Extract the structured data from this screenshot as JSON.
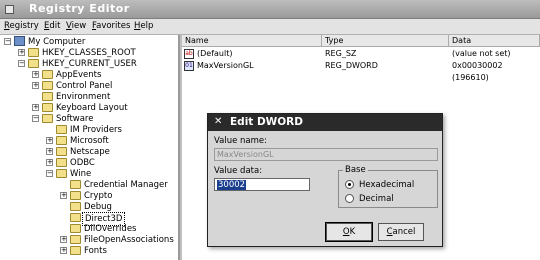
{
  "window": {
    "title": "Registry Editor"
  },
  "menu": [
    "Registry",
    "Edit",
    "View",
    "Favorites",
    "Help"
  ],
  "tree": [
    {
      "label": "My Computer",
      "toggle": "−"
    },
    {
      "label": "HKEY_CLASSES_ROOT",
      "toggle": "+"
    },
    {
      "label": "HKEY_CURRENT_USER",
      "toggle": "−"
    },
    {
      "label": "AppEvents",
      "toggle": "+"
    },
    {
      "label": "Control Panel",
      "toggle": "+"
    },
    {
      "label": "Environment",
      "toggle": ""
    },
    {
      "label": "Keyboard Layout",
      "toggle": "+"
    },
    {
      "label": "Software",
      "toggle": "−"
    },
    {
      "label": "IM Providers",
      "toggle": ""
    },
    {
      "label": "Microsoft",
      "toggle": "+"
    },
    {
      "label": "Netscape",
      "toggle": "+"
    },
    {
      "label": "ODBC",
      "toggle": "+"
    },
    {
      "label": "Wine",
      "toggle": "−"
    },
    {
      "label": "Credential Manager",
      "toggle": ""
    },
    {
      "label": "Crypto",
      "toggle": "+"
    },
    {
      "label": "Debug",
      "toggle": ""
    },
    {
      "label": "Direct3D",
      "toggle": ""
    },
    {
      "label": "DllOverrides",
      "toggle": ""
    },
    {
      "label": "FileOpenAssociations",
      "toggle": "+"
    },
    {
      "label": "Fonts",
      "toggle": "+"
    }
  ],
  "list": {
    "columns": [
      "Name",
      "Type",
      "Data"
    ],
    "rows": [
      {
        "icon": "ab",
        "name": "(Default)",
        "type": "REG_SZ",
        "data": "(value not set)"
      },
      {
        "icon": "01",
        "name": "MaxVersionGL",
        "type": "REG_DWORD",
        "data": "0x00030002 (196610)"
      }
    ]
  },
  "dialog": {
    "title": "Edit DWORD",
    "close_glyph": "✕",
    "value_name_label": "Value name:",
    "value_name": "MaxVersionGL",
    "value_data_label": "Value data:",
    "value_data": "30002",
    "base_label": "Base",
    "hex_label": "Hexadecimal",
    "dec_label": "Decimal",
    "ok_label": "OK",
    "cancel_label": "Cancel"
  }
}
